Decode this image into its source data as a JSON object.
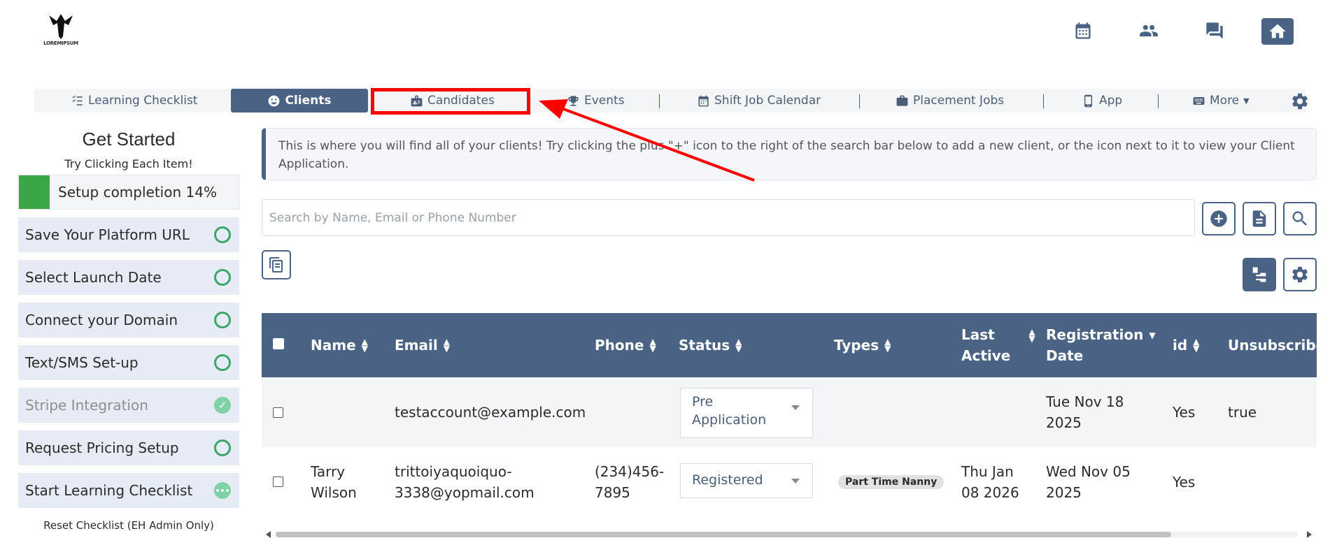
{
  "header": {
    "logo_text": "LOREMIPSUM",
    "icons": [
      "calendar-icon",
      "people-icon",
      "chat-icon",
      "home-icon"
    ]
  },
  "nav": {
    "items": [
      {
        "label": "Learning Checklist",
        "icon": "checklist-icon"
      },
      {
        "label": "Clients",
        "icon": "face-icon",
        "active": true
      },
      {
        "label": "Candidates",
        "icon": "badge-icon"
      },
      {
        "label": "Events",
        "icon": "trophy-icon"
      },
      {
        "label": "Shift Job Calendar",
        "icon": "calendar-icon"
      },
      {
        "label": "Placement Jobs",
        "icon": "briefcase-icon"
      },
      {
        "label": "App",
        "icon": "phone-icon"
      },
      {
        "label": "More",
        "icon": "keyboard-icon"
      }
    ]
  },
  "sidebar": {
    "title": "Get Started",
    "subtitle": "Try Clicking Each Item!",
    "progress_label": "Setup completion 14%",
    "progress": 0.14,
    "items": [
      {
        "label": "Save Your Platform URL",
        "state": "todo"
      },
      {
        "label": "Select Launch Date",
        "state": "todo"
      },
      {
        "label": "Connect your Domain",
        "state": "todo"
      },
      {
        "label": "Text/SMS Set-up",
        "state": "todo"
      },
      {
        "label": "Stripe Integration",
        "state": "done"
      },
      {
        "label": "Request Pricing Setup",
        "state": "todo"
      },
      {
        "label": "Start Learning Checklist",
        "state": "in-progress"
      }
    ],
    "reset_label": "Reset Checklist (EH Admin Only)"
  },
  "info": {
    "text": "This is where you will find all of your clients! Try clicking the plus \"+\" icon to the right of the search bar below to add a new client, or the icon next to it to view your Client Application."
  },
  "search": {
    "placeholder": "Search by Name, Email or Phone Number"
  },
  "table": {
    "headers": {
      "name": "Name",
      "email": "Email",
      "phone": "Phone",
      "status": "Status",
      "types": "Types",
      "last_active_1": "Last",
      "last_active_2": "Active",
      "registration_1": "Registration",
      "registration_2": "Date",
      "id": "id",
      "unsubscribed": "Unsubscribed"
    },
    "rows": [
      {
        "name_1": "",
        "name_2": "",
        "email_1": "testaccount@example.com",
        "email_2": "",
        "phone_1": "",
        "phone_2": "",
        "status_1": "Pre",
        "status_2": "Application",
        "type": "",
        "last_1": "",
        "last_2": "",
        "reg_1": "Tue Nov 18",
        "reg_2": "2025",
        "id": "Yes",
        "unsubscribed": "true"
      },
      {
        "name_1": "Tarry",
        "name_2": "Wilson",
        "email_1": "trittoiyaquoiquo-",
        "email_2": "3338@yopmail.com",
        "phone_1": "(234)456-",
        "phone_2": "7895",
        "status_1": "Registered",
        "status_2": "",
        "type": "Part Time Nanny",
        "last_1": "Thu Jan",
        "last_2": "08 2026",
        "reg_1": "Wed Nov 05",
        "reg_2": "2025",
        "id": "Yes",
        "unsubscribed": ""
      }
    ]
  },
  "colors": {
    "primary": "#4a6384",
    "success": "#3aa645",
    "highlight": "#ff0000"
  }
}
